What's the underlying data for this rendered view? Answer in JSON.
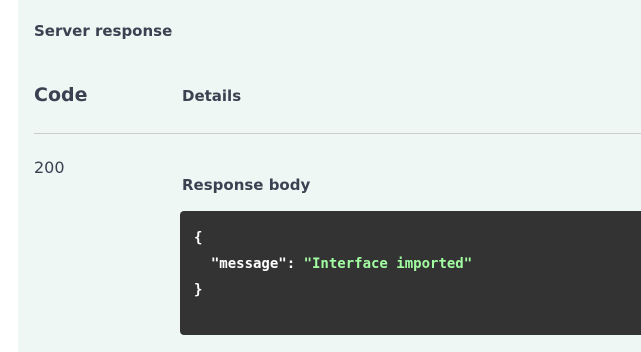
{
  "section": {
    "title": "Server response"
  },
  "table": {
    "headers": {
      "code": "Code",
      "details": "Details"
    },
    "rows": [
      {
        "code": "200",
        "response_body_label": "Response body",
        "response_body": {
          "open_brace": "{",
          "key": "\"message\"",
          "colon": ": ",
          "value": "\"Interface imported\"",
          "close_brace": "}"
        }
      }
    ]
  },
  "colors": {
    "panel_background": "#eef7f3",
    "code_background": "#333333",
    "string_color": "#a2fca2",
    "text_color": "#3b4151"
  }
}
